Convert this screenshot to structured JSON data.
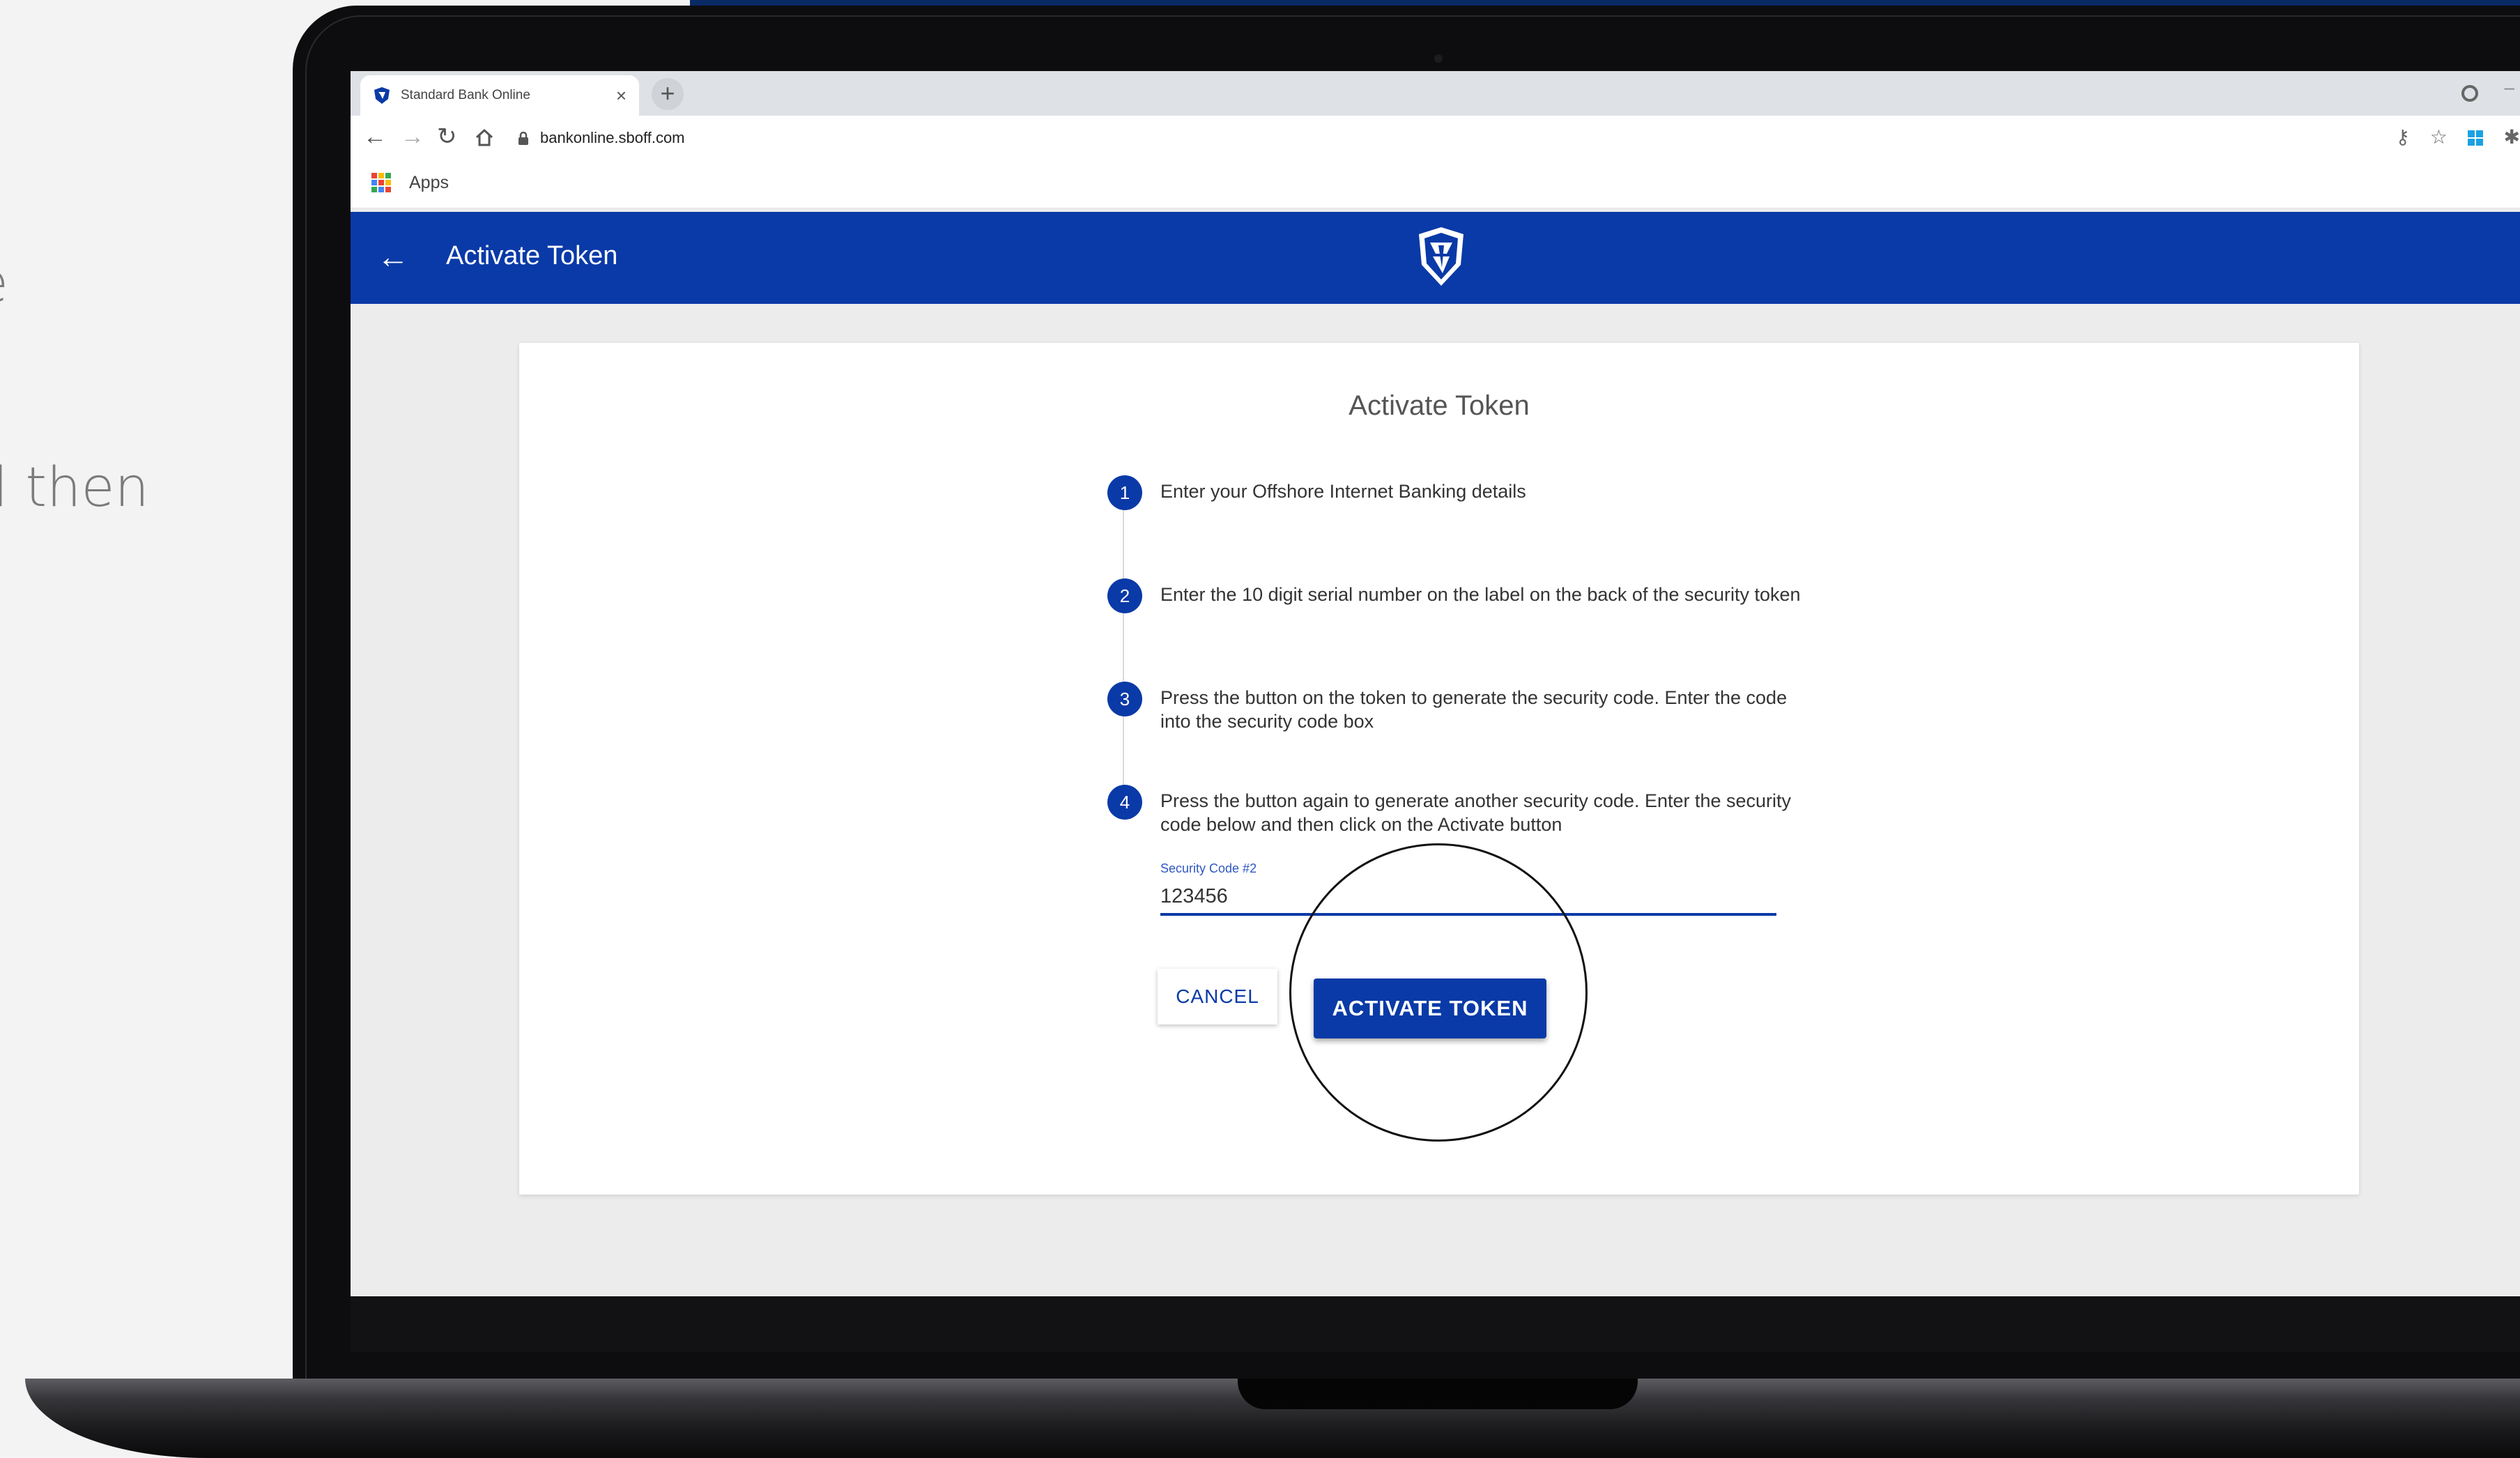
{
  "background_text": {
    "line1": "e",
    "line2": "l then"
  },
  "browser": {
    "tab_title": "Standard Bank Online",
    "tab_close": "×",
    "new_tab": "+",
    "url": "bankonline.sboff.com",
    "bookmarks": [
      {
        "label": "Apps"
      }
    ]
  },
  "header": {
    "back_glyph": "←",
    "title": "Activate Token",
    "brand_color": "#0a3aa7"
  },
  "card": {
    "title": "Activate Token",
    "steps": [
      {
        "number": "1",
        "text": "Enter your Offshore Internet Banking details"
      },
      {
        "number": "2",
        "text": "Enter the 10 digit serial number on the label on the back of the security token"
      },
      {
        "number": "3",
        "text": "Press the button on the token to generate the security code. Enter the code into the security code box"
      },
      {
        "number": "4",
        "text": "Press the button again to generate another security code. Enter the security code below and then click on the Activate button"
      }
    ],
    "security_code": {
      "label": "Security Code #2",
      "value": "123456"
    },
    "buttons": {
      "cancel": "CANCEL",
      "activate": "ACTIVATE TOKEN"
    }
  }
}
